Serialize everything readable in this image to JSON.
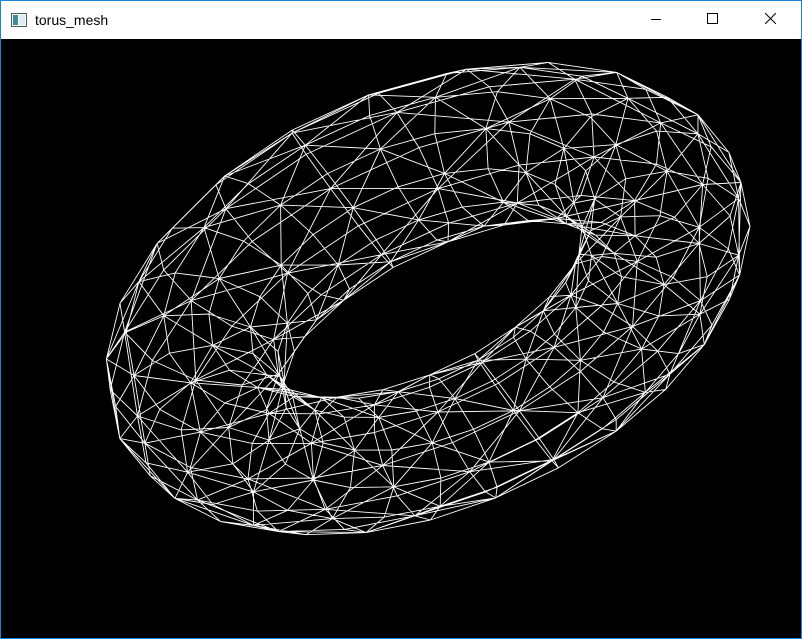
{
  "window": {
    "title": "torus_mesh",
    "icon": "app-window-icon",
    "controls": {
      "minimize_icon": "minimize-icon",
      "maximize_icon": "maximize-icon",
      "close_icon": "close-icon"
    }
  },
  "viewport": {
    "background_color": "#000000",
    "wire_color": "#ffffff",
    "content": "wireframe-torus"
  },
  "colors": {
    "window_border": "#1883d7",
    "titlebar_bg": "#ffffff"
  }
}
